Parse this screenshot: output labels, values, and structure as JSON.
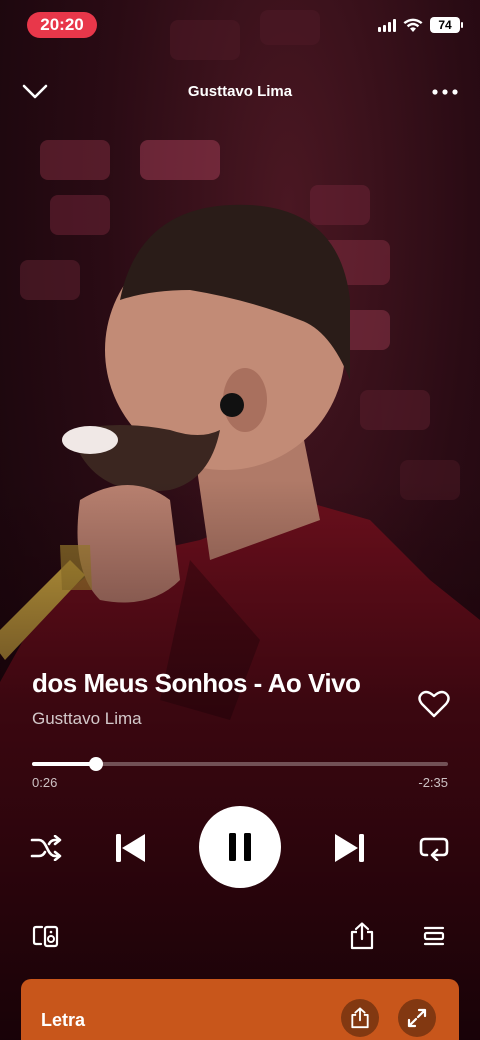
{
  "status_bar": {
    "time": "20:20",
    "battery": "74"
  },
  "header": {
    "title": "Gusttavo Lima"
  },
  "track": {
    "title": "dos Meus Sonhos - Ao Vivo",
    "artist": "Gusttavo Lima"
  },
  "progress": {
    "elapsed": "0:26",
    "remaining": "-2:35",
    "fraction": 0.154
  },
  "lyrics_card": {
    "title": "Letra"
  },
  "colors": {
    "accent_time_pill": "#e8374a",
    "lyrics_card": "#c8561b",
    "background": "#2a0b14"
  },
  "icons": [
    "chevron-down-icon",
    "more-icon",
    "heart-icon",
    "shuffle-icon",
    "previous-icon",
    "pause-icon",
    "next-icon",
    "repeat-icon",
    "devices-icon",
    "share-icon",
    "queue-icon",
    "expand-icon"
  ]
}
